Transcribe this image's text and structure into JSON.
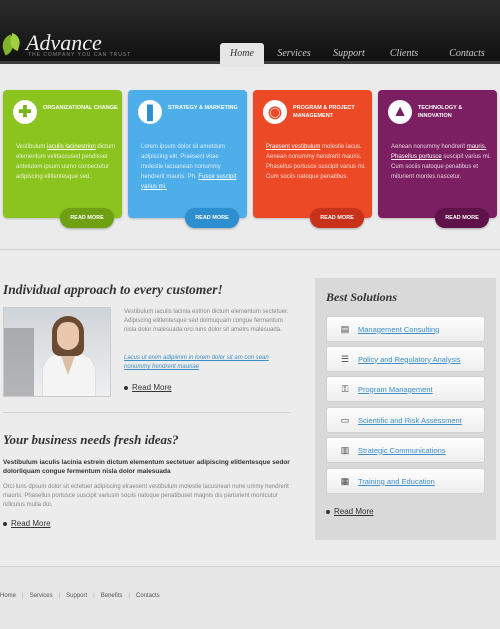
{
  "header": {
    "logo_title": "Advance",
    "logo_tagline": "THE COMPANY YOU CAN TRUST",
    "nav": [
      "Home",
      "Services",
      "Support",
      "Clients",
      "Contacts"
    ],
    "active_nav": "Home"
  },
  "cards": [
    {
      "title": "ORGANIZATIONAL CHANGE",
      "icon": "plus-icon",
      "color": "#8cc41f",
      "btn_color": "#6ea012",
      "body_pre": "Vestibulum ",
      "body_link": "iaculis lacinestrion",
      "body_post": " dictum elementum velitaccused pendisset antelutem ipsum usmo consectetur adipiscing elitlentesque sed.",
      "button": "READ MORE"
    },
    {
      "title": "STRATEGY & MARKETING",
      "icon": "lightbulb-icon",
      "color": "#4daee9",
      "btn_color": "#2e8fd0",
      "body_pre": "Lorem ipsum dolor sit ametdum adipiscing elit. Praesent vitae molestie lacuanean nonummy hendrerit mauris. Ph. ",
      "body_link": "Fusce suscipit varius mi.",
      "body_post": "",
      "button": "READ MORE"
    },
    {
      "title": "PROGRAM & PROJECT MANAGEMENT",
      "icon": "lifebuoy-icon",
      "color": "#ec4a27",
      "btn_color": "#c9321a",
      "body_pre": "",
      "body_link": "Praesent vestibulum",
      "body_post": " molestie lacus. Aenean nonummy hendrerit mauris. Phasellus portusce suscipit varius mi. Cum sociis natoque penatibus.",
      "button": "READ MORE"
    },
    {
      "title": "TECHNOLOGY & INNOVATION",
      "icon": "flask-icon",
      "color": "#7c1f62",
      "btn_color": "#5e1249",
      "body_pre": "Aenean nonummy hendrerit ",
      "body_link": "mauris. Phasellus portusce",
      "body_post": " suscipit varius mi. Cum sociis natoque penatibus et miturient montes nascetur.",
      "button": "READ MORE"
    }
  ],
  "section1": {
    "title": "Individual approach to every customer!",
    "paragraph": "Vestibulum iaculis lacinia estrion dictum elementum sectetuer. Adipiscing elitlentesque sed dolmuquam congue fermentum nisla dolor malesuada orci luns dolor sit ametrs malesuada.",
    "italic_link": "Lacus ut enim adipiimm in lorem dolor sit am con sean nonummy hendrerit mauriae",
    "read_more": "Read More"
  },
  "section2": {
    "title": "Your business needs fresh ideas?",
    "bold_text": "Vestibulum iaculis lacinia estrein dictum elementum sectetuer adipiscing elitlentesque sedor dolorliquam congue fermentum nisla dolor malesuada",
    "paragraph": "Orci luns dpsum dolor sit ectetuer adipiscing elraesent vestibulum molestie lacusnean nune ummy hendrerit mauris. Phasellus portusce suscipit variusm sociis natoque penatibuset magnis dis parturient montcutur ridiculus mulla dui.",
    "read_more": "Read More"
  },
  "sidebar": {
    "title": "Best Solutions",
    "items": [
      {
        "label": "Management Consulting",
        "icon": "document-icon"
      },
      {
        "label": "Policy and Regulatory Analysis",
        "icon": "server-icon"
      },
      {
        "label": "Program Management",
        "icon": "lock-icon"
      },
      {
        "label": "Scientific and Risk Assessment",
        "icon": "monitor-icon"
      },
      {
        "label": "Strategic Communications",
        "icon": "chart-icon"
      },
      {
        "label": "Training and Education",
        "icon": "calculator-icon"
      }
    ],
    "read_more": "Read More"
  },
  "footer": {
    "links": [
      "Home",
      "Services",
      "Support",
      "Benefits",
      "Contacts"
    ]
  }
}
